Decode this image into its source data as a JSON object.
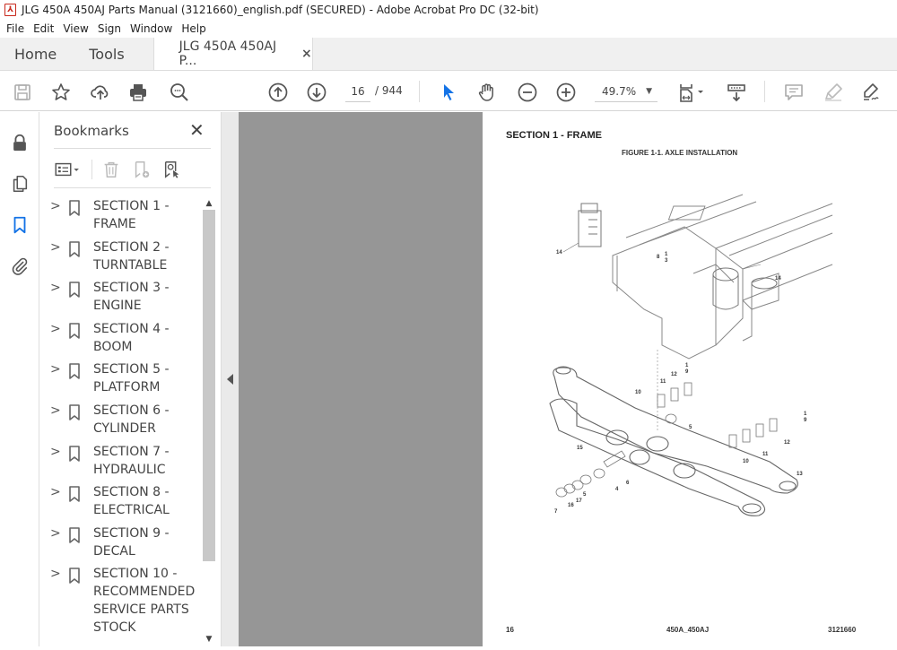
{
  "window": {
    "title": "JLG 450A 450AJ Parts Manual (3121660)_english.pdf (SECURED) - Adobe Acrobat Pro DC (32-bit)"
  },
  "menu": [
    "File",
    "Edit",
    "View",
    "Sign",
    "Window",
    "Help"
  ],
  "tabs": {
    "home": "Home",
    "tools": "Tools",
    "document": "JLG 450A 450AJ P...",
    "close": "×"
  },
  "toolbar": {
    "icons": [
      "save-icon",
      "star-icon",
      "upload-cloud-icon",
      "print-icon",
      "search-zoom-icon",
      "page-up-icon",
      "page-down-icon",
      "select-arrow-icon",
      "hand-icon",
      "zoom-out-icon",
      "zoom-in-icon",
      "fit-page-icon",
      "scroll-mode-icon",
      "comment-icon",
      "highlight-icon",
      "sign-icon"
    ],
    "current_page": "16",
    "total_pages": "/ 944",
    "zoom_level": "49.7%"
  },
  "left_rail": {
    "icons": [
      "lock-icon",
      "pages-icon",
      "bookmark-icon",
      "attachment-icon"
    ],
    "active": "bookmark-icon"
  },
  "bookmarks_panel": {
    "title": "Bookmarks",
    "close": "✕",
    "items": [
      {
        "label": "SECTION 1 - FRAME"
      },
      {
        "label": "SECTION 2 - TURNTABLE"
      },
      {
        "label": "SECTION 3 - ENGINE"
      },
      {
        "label": "SECTION 4 - BOOM"
      },
      {
        "label": "SECTION 5 - PLATFORM"
      },
      {
        "label": "SECTION 6 - CYLINDER"
      },
      {
        "label": "SECTION 7 - HYDRAULIC"
      },
      {
        "label": "SECTION 8 - ELECTRICAL"
      },
      {
        "label": "SECTION 9 - DECAL"
      },
      {
        "label": "SECTION 10 - RECOMMENDED SERVICE PARTS STOCK"
      }
    ]
  },
  "pdf_page": {
    "section_heading": "SECTION 1 - FRAME",
    "figure_title": "FIGURE 1-1. AXLE INSTALLATION",
    "footer_left": "16",
    "footer_center": "450A_450AJ",
    "footer_right": "3121660",
    "callouts": [
      "14",
      "8",
      "1",
      "3",
      "14",
      "1",
      "9",
      "12",
      "11",
      "10",
      "5",
      "15",
      "1",
      "9",
      "12",
      "11",
      "10",
      "6",
      "4",
      "5",
      "17",
      "16",
      "7",
      "13"
    ]
  },
  "colors": {
    "accent_blue": "#1473e6",
    "pdf_red": "#c8281c",
    "doc_background": "#969696"
  }
}
